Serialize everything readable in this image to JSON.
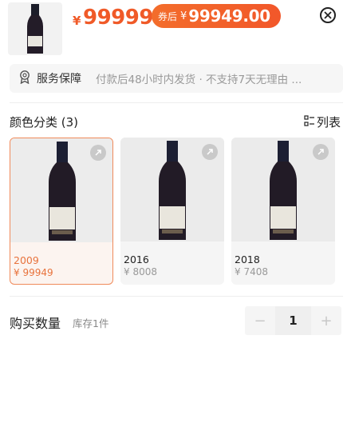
{
  "header": {
    "price_symbol": "¥",
    "price": "99999",
    "coupon_label": "券后",
    "coupon_symbol": "¥",
    "coupon_price": "99949.00"
  },
  "service": {
    "title": "服务保障",
    "description": "付款后48小时内发货 · 不支持7天无理由 ..."
  },
  "variants": {
    "title": "颜色分类 (3)",
    "list_toggle_label": "列表",
    "items": [
      {
        "year": "2009",
        "price": "¥ 99949",
        "selected": true
      },
      {
        "year": "2016",
        "price": "¥ 8008",
        "selected": false
      },
      {
        "year": "2018",
        "price": "¥ 7408",
        "selected": false
      }
    ]
  },
  "quantity": {
    "label": "购买数量",
    "stock": "库存1件",
    "value": "1",
    "minus": "−",
    "plus": "+"
  },
  "colors": {
    "accent": "#f05a28",
    "selected_border": "#f08a5a"
  }
}
